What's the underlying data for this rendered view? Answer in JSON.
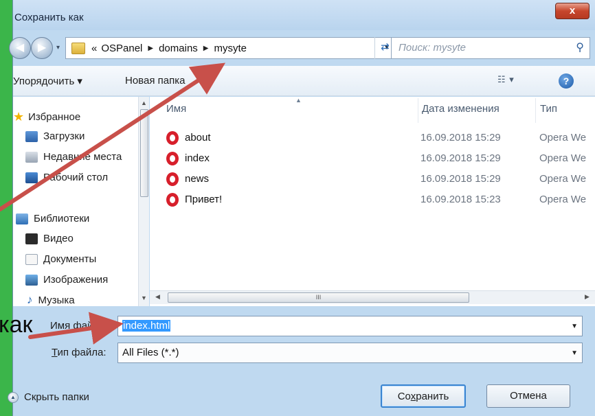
{
  "slide": {
    "partial_text": "как"
  },
  "dialog": {
    "title": "Сохранить как",
    "close_label": "x"
  },
  "address_bar": {
    "prefix": "«",
    "crumbs": [
      "OSPanel",
      "domains",
      "mysyte"
    ],
    "search_placeholder": "Поиск: mysyte"
  },
  "toolbar": {
    "organize": "Упорядочить ▾",
    "new_folder": "Новая папка",
    "view": "☷ ▾",
    "help": "?"
  },
  "sidebar": {
    "items": [
      {
        "label": "Избранное",
        "icon": "star-icon"
      },
      {
        "label": "Загрузки",
        "icon": "downloads-icon"
      },
      {
        "label": "Недавние места",
        "icon": "recent-places-icon"
      },
      {
        "label": "Рабочий стол",
        "icon": "desktop-icon"
      },
      {
        "label": "Библиотеки",
        "icon": "libraries-icon"
      },
      {
        "label": "Видео",
        "icon": "video-icon"
      },
      {
        "label": "Документы",
        "icon": "documents-icon"
      },
      {
        "label": "Изображения",
        "icon": "pictures-icon"
      },
      {
        "label": "Музыка",
        "icon": "music-icon"
      }
    ]
  },
  "file_list": {
    "columns": {
      "name": "Имя",
      "date": "Дата изменения",
      "type": "Тип"
    },
    "rows": [
      {
        "name": "about",
        "date": "16.09.2018 15:29",
        "type": "Opera We"
      },
      {
        "name": "index",
        "date": "16.09.2018 15:29",
        "type": "Opera We"
      },
      {
        "name": "news",
        "date": "16.09.2018 15:29",
        "type": "Opera We"
      },
      {
        "name": "Привет!",
        "date": "16.09.2018 15:23",
        "type": "Opera We"
      }
    ],
    "hscroll_grip": "III"
  },
  "form": {
    "filename_label": "Имя файла:",
    "filename_value": "index.html",
    "filetype_label_accel": "Т",
    "filetype_label_rest": "ип файла:",
    "filetype_value": "All Files (*.*)"
  },
  "footer": {
    "hide_folders": "Скрыть папки",
    "save_accel_before": "Со",
    "save_accel": "х",
    "save_accel_after": "ранить",
    "cancel": "Отмена"
  },
  "colors": {
    "slide_background": "#3bb54a",
    "annotation_arrow": "#c8504a",
    "selection": "#3399ff"
  }
}
